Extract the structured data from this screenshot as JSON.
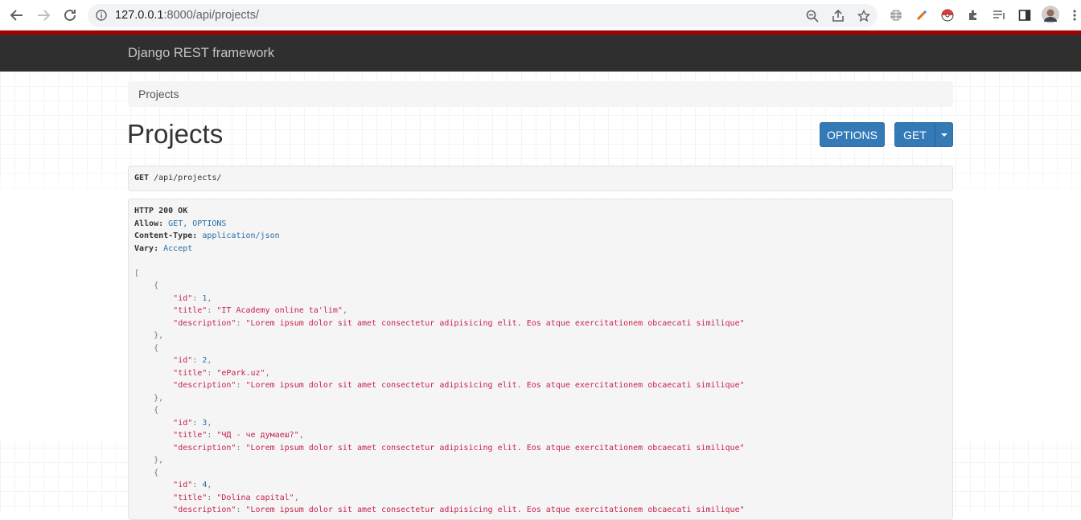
{
  "browser": {
    "url_host": "127.0.0.1",
    "url_rest": ":8000/api/projects/"
  },
  "navbar": {
    "brand": "Django REST framework"
  },
  "breadcrumb": {
    "label": "Projects"
  },
  "page": {
    "title": "Projects"
  },
  "buttons": {
    "options": "OPTIONS",
    "get": "GET"
  },
  "request": {
    "method": "GET",
    "path": "/api/projects/"
  },
  "response": {
    "status": "HTTP 200 OK",
    "headers": [
      {
        "name": "Allow:",
        "value": "GET, OPTIONS"
      },
      {
        "name": "Content-Type:",
        "value": "application/json"
      },
      {
        "name": "Vary:",
        "value": "Accept"
      }
    ],
    "projects": [
      {
        "id": "1",
        "title": "\"IT Academy online ta'lim\"",
        "description": "\"Lorem ipsum dolor sit amet consectetur adipisicing elit. Eos atque exercitationem obcaecati similique\""
      },
      {
        "id": "2",
        "title": "\"ePark.uz\"",
        "description": "\"Lorem ipsum dolor sit amet consectetur adipisicing elit. Eos atque exercitationem obcaecati similique\""
      },
      {
        "id": "3",
        "title": "\"ЧД - че думаеш?\"",
        "description": "\"Lorem ipsum dolor sit amet consectetur adipisicing elit. Eos atque exercitationem obcaecati similique\""
      },
      {
        "id": "4",
        "title": "\"Dolina capital\"",
        "description": "\"Lorem ipsum dolor sit amet consectetur adipisicing elit. Eos atque exercitationem obcaecati similique\""
      }
    ],
    "keys": {
      "id": "\"id\"",
      "title": "\"title\"",
      "description": "\"description\""
    }
  }
}
